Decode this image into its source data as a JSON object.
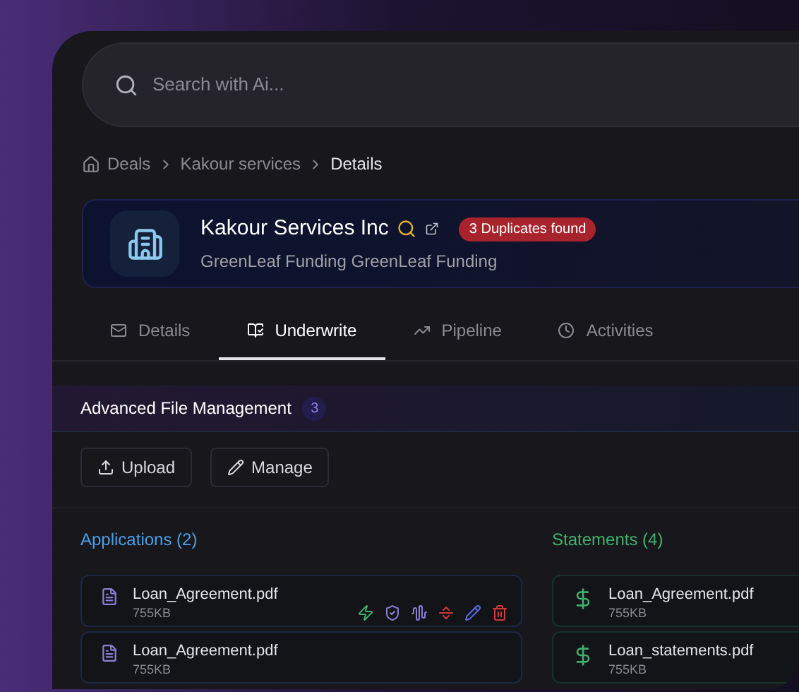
{
  "search": {
    "placeholder": "Search with Ai..."
  },
  "breadcrumb": [
    {
      "label": "Deals",
      "current": false
    },
    {
      "label": "Kakour services",
      "current": false
    },
    {
      "label": "Details",
      "current": true
    }
  ],
  "company": {
    "name": "Kakour Services Inc",
    "badge": "3 Duplicates found",
    "subtitle": "GreenLeaf Funding GreenLeaf Funding"
  },
  "tabs": [
    {
      "label": "Details",
      "kind": "mail",
      "selected": false
    },
    {
      "label": "Underwrite",
      "kind": "book",
      "selected": true
    },
    {
      "label": "Pipeline",
      "kind": "trend",
      "selected": false
    },
    {
      "label": "Activities",
      "kind": "clock",
      "selected": false
    }
  ],
  "section": {
    "title": "Advanced File Management",
    "count": "3"
  },
  "buttons": [
    {
      "label": "Upload",
      "kind": "upload"
    },
    {
      "label": "Manage",
      "kind": "pencil"
    }
  ],
  "columns": [
    {
      "title": "Applications (2)",
      "kind": "document",
      "files": [
        {
          "name": "Loan_Agreement.pdf",
          "size": "755KB",
          "show_actions": true
        },
        {
          "name": "Loan_Agreement.pdf",
          "size": "755KB",
          "show_actions": false
        }
      ]
    },
    {
      "title": "Statements (4)",
      "kind": "money",
      "files": [
        {
          "name": "Loan_Agreement.pdf",
          "size": "755KB",
          "show_actions": false
        },
        {
          "name": "Loan_statements.pdf",
          "size": "755KB",
          "show_actions": false
        }
      ]
    }
  ]
}
